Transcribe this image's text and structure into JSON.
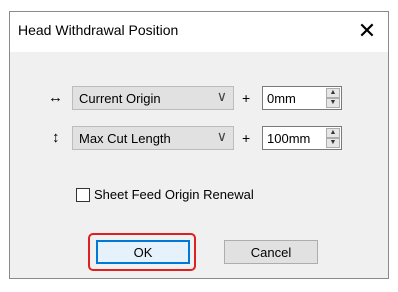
{
  "dialog": {
    "title": "Head Withdrawal Position",
    "close_glyph": "✕"
  },
  "rows": [
    {
      "icon": "↔",
      "icon_name": "horizontal-arrow-icon",
      "select_value": "Current Origin",
      "plus": "+",
      "spin_value": "0mm"
    },
    {
      "icon": "↕",
      "icon_name": "vertical-arrow-icon",
      "select_value": "Max Cut Length",
      "plus": "+",
      "spin_value": "100mm"
    }
  ],
  "glyphs": {
    "chevron": "∨",
    "up": "▲",
    "down": "▼"
  },
  "checkbox": {
    "label": "Sheet Feed Origin Renewal",
    "checked": false
  },
  "buttons": {
    "ok": "OK",
    "cancel": "Cancel"
  },
  "colors": {
    "highlight": "#e02020",
    "focus": "#0078d7"
  }
}
